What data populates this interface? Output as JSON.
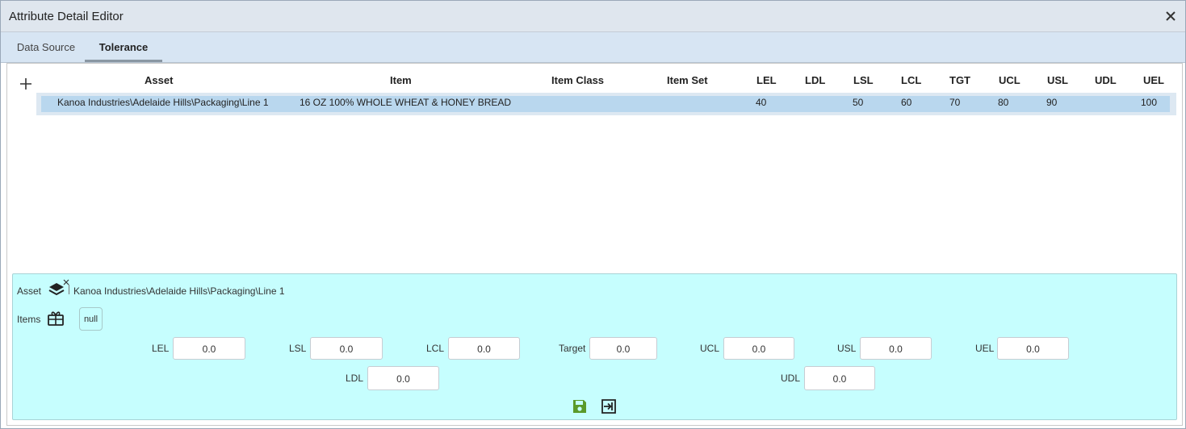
{
  "window": {
    "title": "Attribute Detail Editor"
  },
  "tabs": [
    {
      "label": "Data Source"
    },
    {
      "label": "Tolerance"
    }
  ],
  "table": {
    "headers": [
      "Asset",
      "Item",
      "Item Class",
      "Item Set",
      "LEL",
      "LDL",
      "LSL",
      "LCL",
      "TGT",
      "UCL",
      "USL",
      "UDL",
      "UEL"
    ],
    "rows": [
      {
        "asset": "Kanoa Industries\\Adelaide Hills\\Packaging\\Line 1",
        "item": "16 OZ 100% WHOLE WHEAT & HONEY BREAD",
        "item_class": "",
        "item_set": "",
        "lel": "40",
        "ldl": "",
        "lsl": "50",
        "lcl": "60",
        "tgt": "70",
        "ucl": "80",
        "usl": "90",
        "udl": "",
        "uel": "100"
      }
    ]
  },
  "form": {
    "asset_label": "Asset",
    "asset_value": "Kanoa Industries\\Adelaide Hills\\Packaging\\Line 1",
    "items_label": "Items",
    "items_value": "null",
    "fields": {
      "lel": {
        "label": "LEL",
        "value": "0.0"
      },
      "lsl": {
        "label": "LSL",
        "value": "0.0"
      },
      "lcl": {
        "label": "LCL",
        "value": "0.0"
      },
      "target": {
        "label": "Target",
        "value": "0.0"
      },
      "ucl": {
        "label": "UCL",
        "value": "0.0"
      },
      "usl": {
        "label": "USL",
        "value": "0.0"
      },
      "uel": {
        "label": "UEL",
        "value": "0.0"
      },
      "ldl": {
        "label": "LDL",
        "value": "0.0"
      },
      "udl": {
        "label": "UDL",
        "value": "0.0"
      }
    }
  },
  "icons": {
    "close": "close-icon",
    "add": "plus-icon",
    "asset": "layers-icon",
    "items": "gift-icon",
    "save": "save-icon",
    "exit": "exit-icon"
  },
  "colors": {
    "selected_row": "#b9d7ee",
    "form_background": "#c6fefe",
    "save_icon": "#5a9a2a"
  }
}
